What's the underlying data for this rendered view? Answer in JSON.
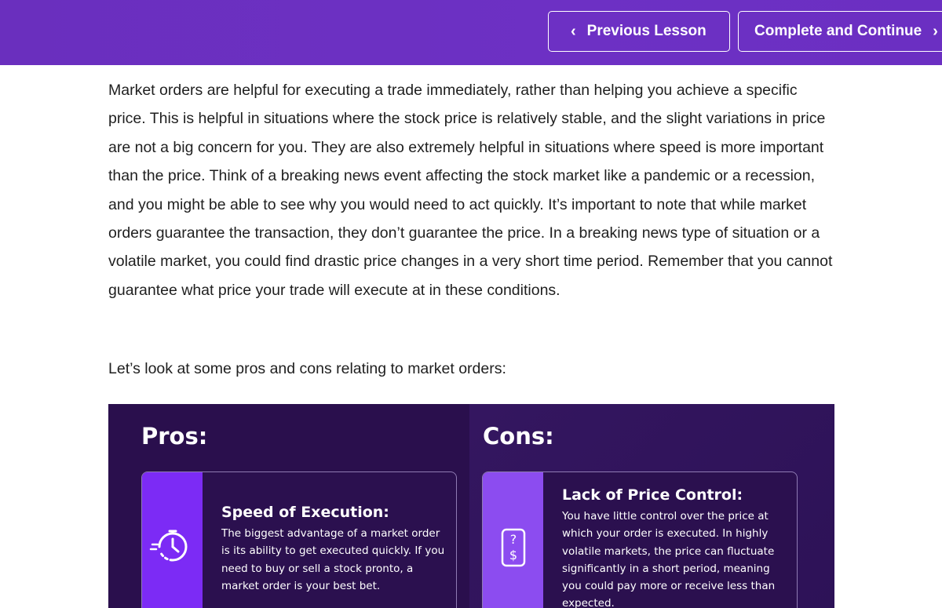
{
  "header": {
    "prev_label": "Previous Lesson",
    "next_label": "Complete and Continue",
    "bar_color": "#6a2fbe"
  },
  "content": {
    "paragraph": "Market orders are helpful for executing a trade immediately, rather than helping you achieve a specific price. This is helpful in situations where the stock price is relatively stable, and the slight variations in price are not a big concern for you. They are also extremely helpful in situations where speed is more important than the price. Think of a breaking news event affecting the stock market like a pandemic or a recession, and you might be able to see why you would need to act quickly. It’s important to note that while market orders guarantee the transaction, they don’t guarantee the price. In a breaking news type of situation or a volatile market, you could find drastic price changes in a very short time period. Remember that you cannot guarantee what price your trade will execute at in these conditions.",
    "intro": "Let’s look at some pros and cons relating to market orders:"
  },
  "graphic": {
    "pros_title": "Pros:",
    "cons_title": "Cons:",
    "pros_card": {
      "title": "Speed of Execution:",
      "text": "The biggest advantage of a market order is its ability to get executed quickly. If you need to buy or sell a stock pronto, a market order is your best bet.",
      "icon": "clock-speed-icon"
    },
    "cons_card": {
      "title": "Lack of Price Control:",
      "text": "You have little control over the price at which your order is executed. In highly volatile markets, the price can fluctuate significantly in a short period, meaning you could pay more or receive less than expected.",
      "icon": "price-tag-question-icon"
    },
    "accent_color": "#7c2bf5",
    "background_color": "#2a0f4d"
  }
}
